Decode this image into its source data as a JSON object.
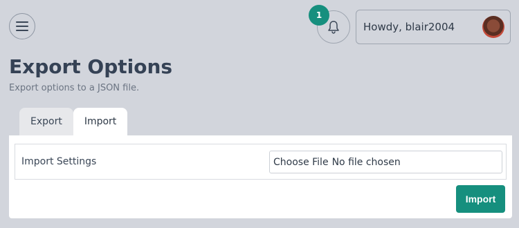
{
  "header": {
    "menu_icon": "hamburger-icon",
    "bell_icon": "bell-icon",
    "notification_count": "1",
    "greeting": "Howdy, blair2004",
    "avatar_icon": "user-avatar"
  },
  "page": {
    "title": "Export Options",
    "subtitle": "Export options to a JSON file."
  },
  "tabs": [
    {
      "label": "Export",
      "active": false
    },
    {
      "label": "Import",
      "active": true
    }
  ],
  "import_panel": {
    "settings_label": "Import Settings",
    "file_button_label": "Choose File",
    "file_status": "No file chosen",
    "submit_label": "Import"
  },
  "colors": {
    "background": "#d2d5dc",
    "accent": "#168f7e",
    "panel": "#ffffff"
  }
}
